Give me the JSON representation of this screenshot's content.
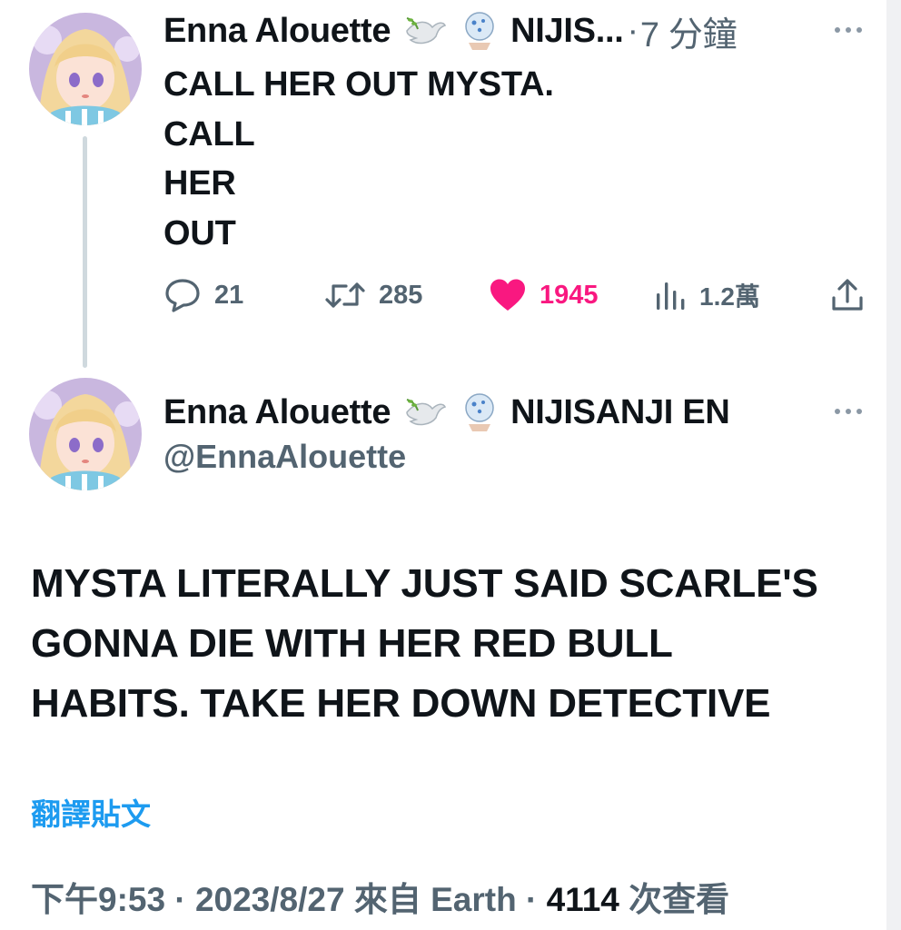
{
  "reply_tweet": {
    "author_name": "Enna Alouette",
    "author_badge_short": "NIJIS...",
    "time_sep": "·",
    "time_ago": "7 分鐘",
    "lines": [
      "CALL HER OUT MYSTA.",
      "CALL",
      "HER",
      "OUT"
    ],
    "actions": {
      "replies": "21",
      "retweets": "285",
      "likes": "1945",
      "views": "1.2萬"
    }
  },
  "main_tweet": {
    "author_name": "Enna Alouette",
    "author_badge": "NIJISANJI EN",
    "handle": "@EnnaAlouette",
    "lines": [
      "MYSTA LITERALLY JUST SAID SCARLE'S",
      "GONNA DIE WITH HER RED BULL",
      "HABITS. TAKE HER DOWN DETECTIVE"
    ],
    "translate_label": "翻譯貼文",
    "meta": {
      "time": "下午9:53",
      "sep1": " · ",
      "date": "2023/8/27",
      "source": " 來自 Earth",
      "sep2": " · ",
      "views_count": "4114",
      "views_label": " 次查看"
    }
  },
  "icons": {
    "dove": "dove-icon",
    "badge": "crystal-ball-icon",
    "more": "more-horizontal-icon",
    "reply": "speech-bubble-icon",
    "retweet": "retweet-icon",
    "like": "heart-icon",
    "views": "bar-chart-icon",
    "share": "share-icon"
  },
  "colors": {
    "text": "#0f1419",
    "secondary": "#536471",
    "like": "#f91880",
    "link": "#1d9bf0"
  }
}
